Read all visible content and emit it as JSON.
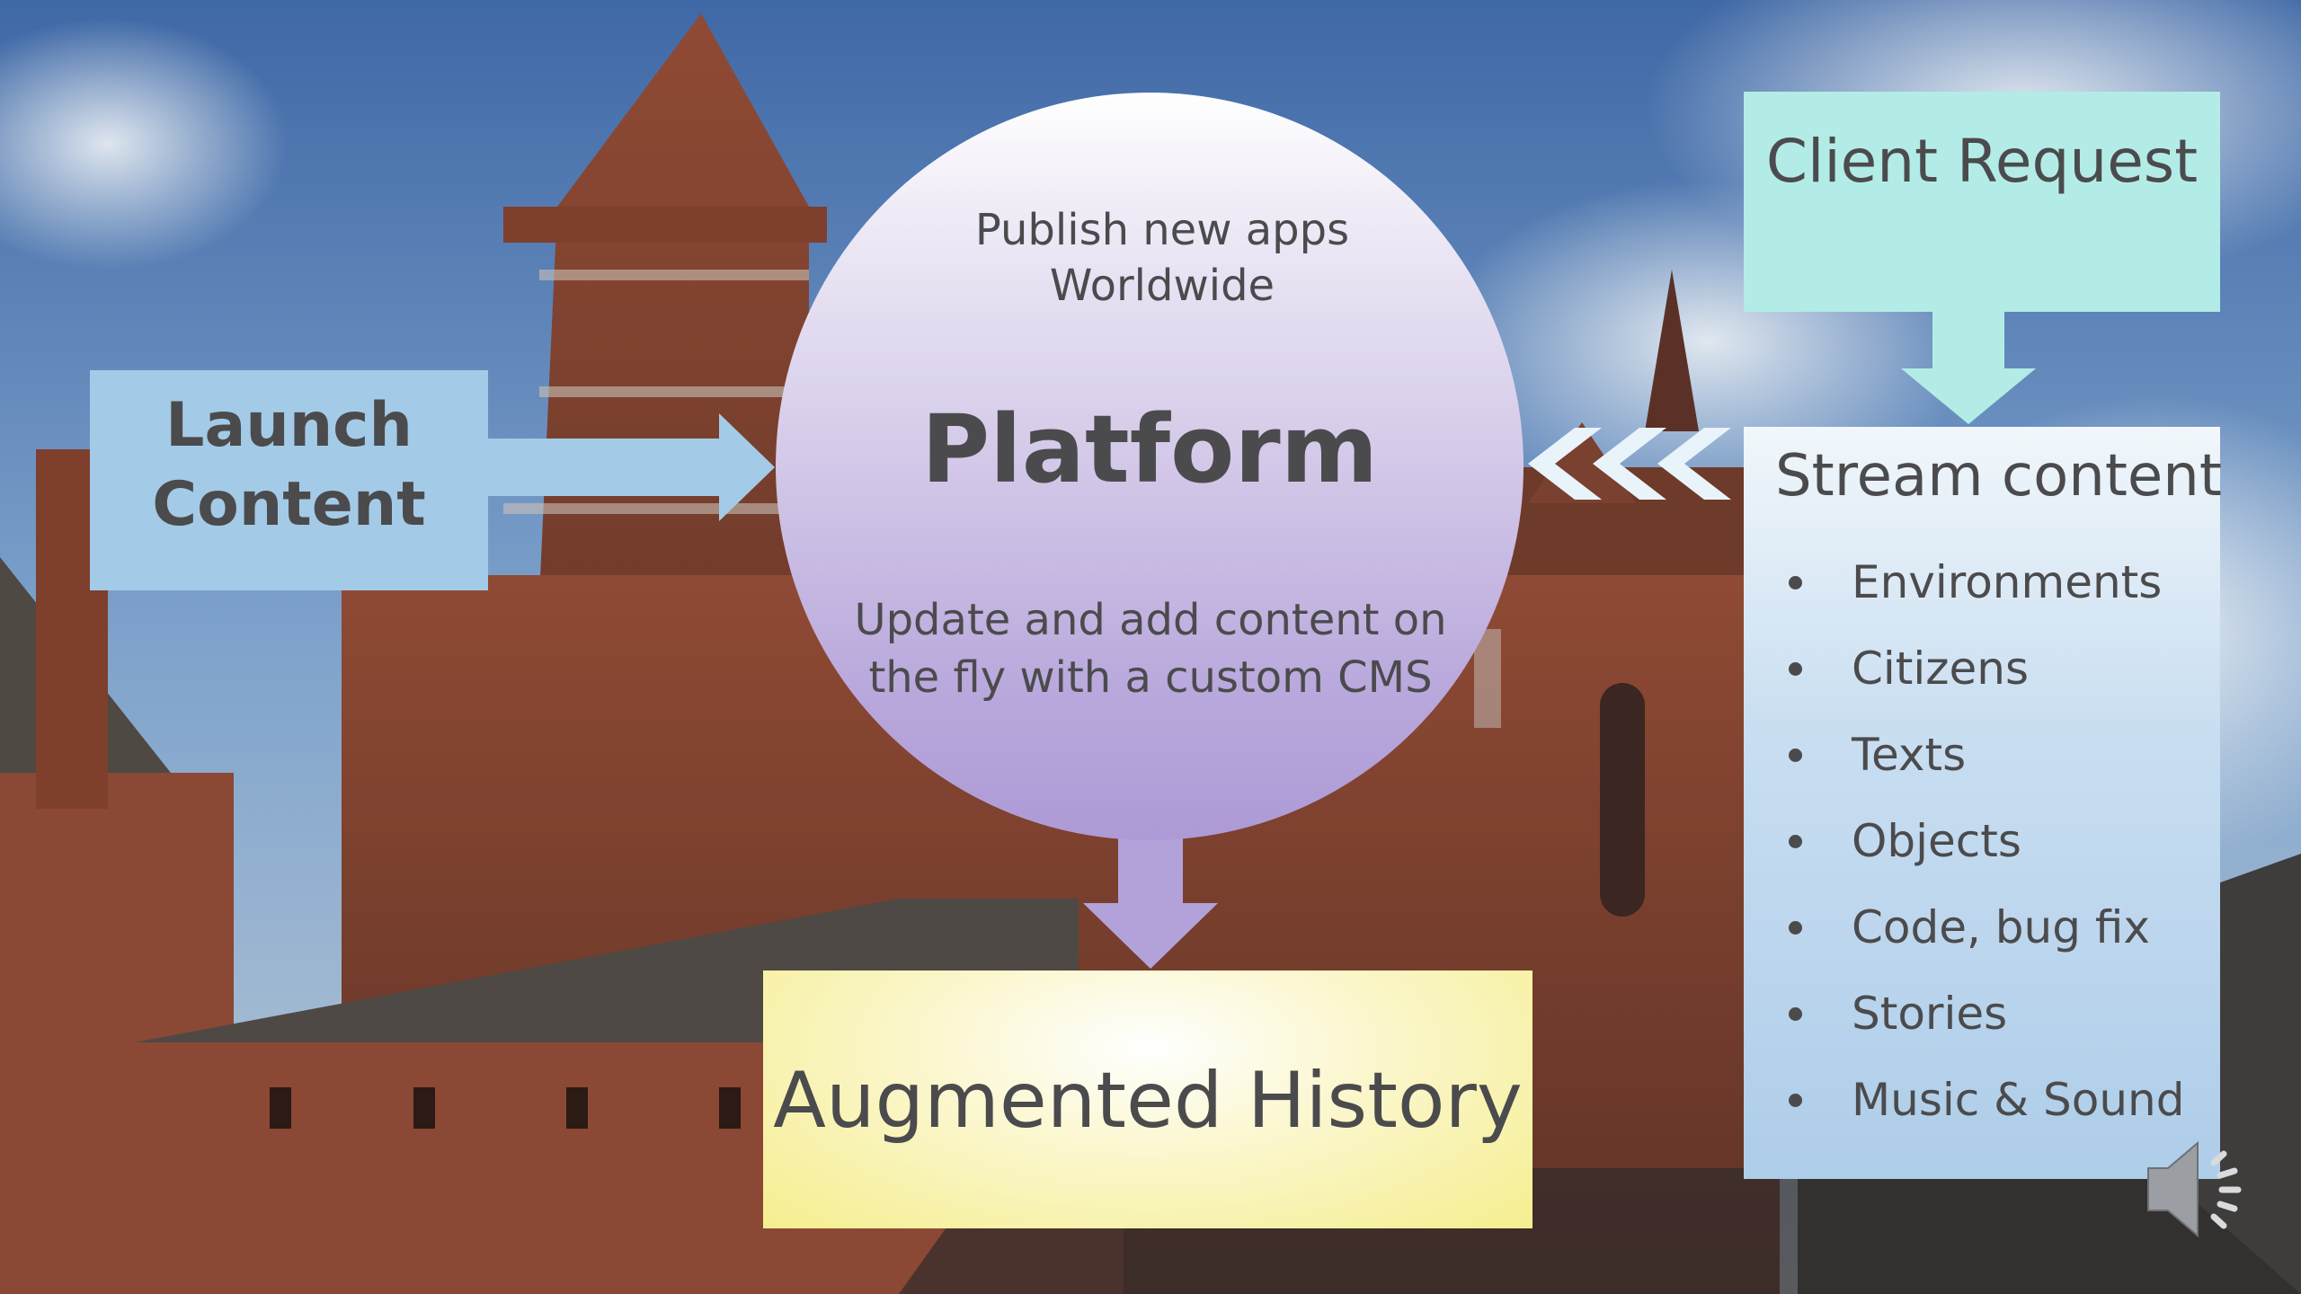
{
  "launch": {
    "text": "Launch Content"
  },
  "platform": {
    "top_text": "Publish new apps Worldwide",
    "title": "Platform",
    "bottom_text": "Update and add content on the fly with a custom CMS"
  },
  "client": {
    "text": "Client Request"
  },
  "stream": {
    "title": "Stream content",
    "items": [
      {
        "label": "Environments"
      },
      {
        "label": "Citizens"
      },
      {
        "label": "Texts"
      },
      {
        "label": "Objects"
      },
      {
        "label": "Code, bug fix"
      },
      {
        "label": "Stories"
      },
      {
        "label": "Music & Sound"
      }
    ]
  },
  "history": {
    "text": "Augmented History"
  },
  "icons": {
    "audio": "speaker-icon"
  },
  "colors": {
    "launch": "#a3cbe7",
    "client": "#b3ece7",
    "stream": "#aecde9",
    "platform": "#b9a8dc",
    "history": "#f5ee8f",
    "text": "#4b4b4d"
  }
}
